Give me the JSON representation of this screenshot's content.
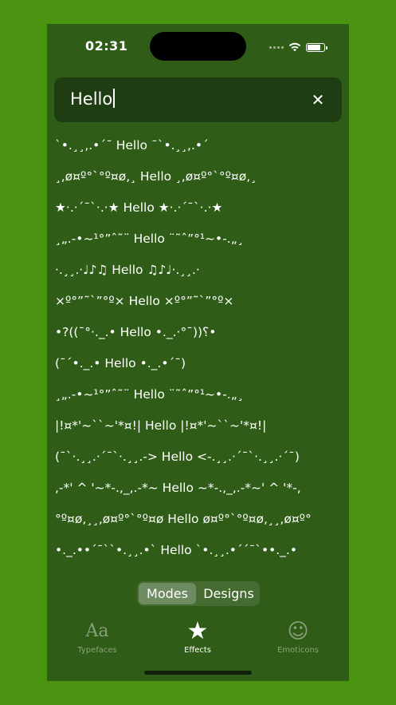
{
  "status": {
    "time": "02:31",
    "battery_level": 0.9
  },
  "search": {
    "value": "Hello",
    "clear_icon": "close-icon"
  },
  "effects": [
    "`•.¸¸,.•´¯ Hello ¯`•.¸¸,.•´",
    "¸,ø¤º°`°º¤ø,¸ Hello ¸,ø¤º°`°º¤ø,¸",
    "★·.·´¯`·.·★ Hello ★·.·´¯`·.·★",
    "¸„.-•~¹°”ˆ˜¨ Hello ¨˜ˆ”°¹~•-.„¸",
    "·.¸¸.·♩♪♫ Hello ♫♪♩·.¸¸.·",
    "×º°”˜`”°º× Hello ×º°”˜`”°º×",
    "•?((¯°·._.• Hello •._.·°¯))؟•",
    "(¯´•._.• Hello •._.•´¯)",
    "¸„.-•~¹°”ˆ˜¨ Hello ¨˜ˆ”°¹~•-.„¸",
    "|!¤*'~``~'*¤!| Hello |!¤*'~``~'*¤!|",
    "(¯`·.¸¸.·´¯`·.¸¸.-> Hello <-.¸¸.·´¯`·.¸¸.·´¯)",
    ",-*' ^ '~*-.,_,.-*~ Hello ~*-.,_,.-*~' ^ '*-,",
    "°º¤ø,¸¸,ø¤º°`°º¤ø Hello ø¤º°`°º¤ø,¸¸,ø¤º°",
    "•._.••´¯``•.¸¸.•` Hello `•.¸¸.•´´¯`••._.•"
  ],
  "segment": {
    "modes": "Modes",
    "designs": "Designs",
    "selected": "Modes"
  },
  "tabbar": {
    "typefaces": {
      "label": "Typefaces",
      "icon": "Aa"
    },
    "effects": {
      "label": "Effects",
      "icon": "★"
    },
    "emoticons": {
      "label": "Emoticons",
      "icon": "☺"
    }
  }
}
